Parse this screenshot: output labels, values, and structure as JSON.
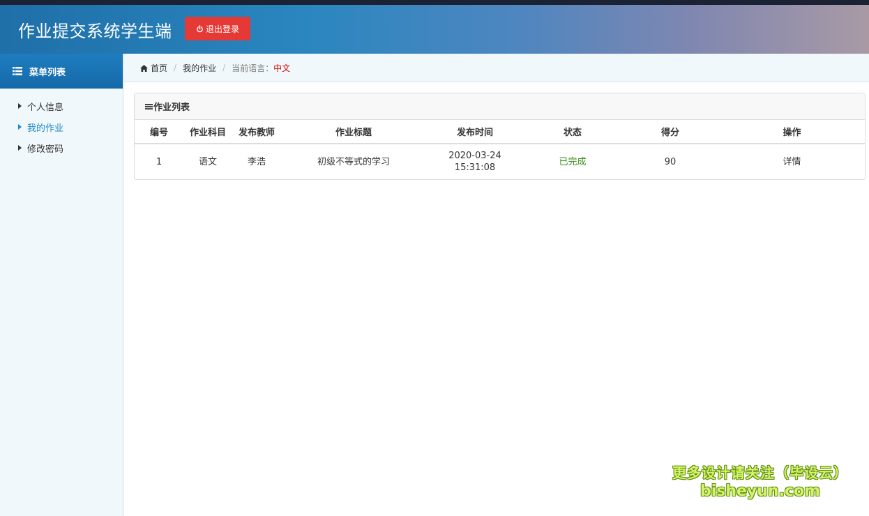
{
  "app": {
    "title": "作业提交系统学生端",
    "logout_label": "退出登录"
  },
  "sidebar": {
    "heading": "菜单列表",
    "items": [
      {
        "label": "个人信息",
        "active": false
      },
      {
        "label": "我的作业",
        "active": true
      },
      {
        "label": "修改密码",
        "active": false
      }
    ]
  },
  "breadcrumb": {
    "home": "首页",
    "current": "我的作业",
    "lang_label": "当前语言：",
    "lang_value": "中文"
  },
  "panel": {
    "title": "作业列表",
    "columns": [
      "编号",
      "作业科目",
      "发布教师",
      "作业标题",
      "发布时间",
      "状态",
      "得分",
      "操作"
    ],
    "rows": [
      {
        "id": "1",
        "subject": "语文",
        "teacher": "李浩",
        "title": "初级不等式的学习",
        "date": "2020-03-24",
        "time": "15:31:08",
        "status": "已完成",
        "score": "90",
        "action": "详情"
      }
    ]
  },
  "watermark": {
    "line1": "更多设计请关注（毕设云）",
    "line2": "bisheyun.com"
  },
  "colors": {
    "accent": "#1e88c7",
    "logout": "#e53935",
    "status_done": "#3c8a18",
    "lang_value": "#dd0000"
  }
}
